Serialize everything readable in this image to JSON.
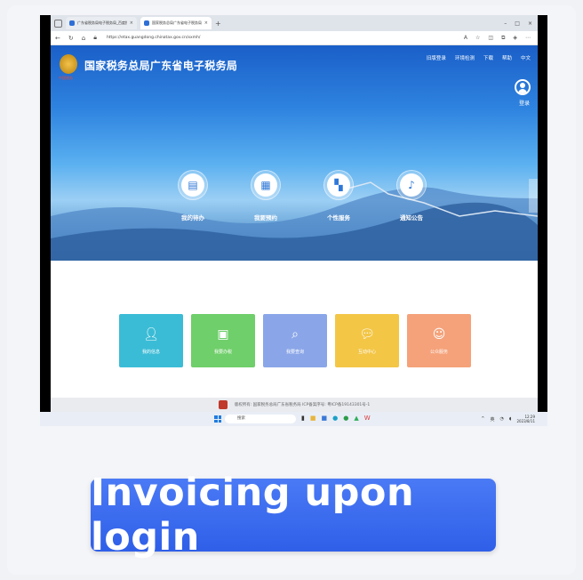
{
  "browser": {
    "tabs": [
      {
        "title": "广东省税务局电子税务局_百度搜",
        "active": false
      },
      {
        "title": "国家税务总局广东省电子税务局",
        "active": true
      }
    ],
    "new_tab": "+",
    "window_controls": [
      "–",
      "□",
      "×"
    ],
    "url": "https://etax.guangdong.chinatax.gov.cn/xxmh/"
  },
  "site": {
    "emblem_caption": "中国税务",
    "title": "国家税务总局广东省电子税务局",
    "top_links": [
      "旧版登录",
      "环境检测",
      "下载",
      "帮助",
      "中文"
    ],
    "login_label": "登录",
    "hero_items": [
      {
        "label": "我的待办",
        "icon": "document-icon"
      },
      {
        "label": "我要预约",
        "icon": "calendar-icon"
      },
      {
        "label": "个性服务",
        "icon": "grid-icon"
      },
      {
        "label": "通知公告",
        "icon": "bell-icon"
      }
    ],
    "tiles": [
      {
        "label": "我的信息",
        "color": "#3bbcd6",
        "icon": "person-icon"
      },
      {
        "label": "我要办税",
        "color": "#6fcf6a",
        "icon": "monitor-icon"
      },
      {
        "label": "我要查询",
        "color": "#8aa6e8",
        "icon": "search-doc-icon"
      },
      {
        "label": "互动中心",
        "color": "#f3c646",
        "icon": "chat-icon"
      },
      {
        "label": "公众服务",
        "color": "#f5a27a",
        "icon": "service-icon"
      }
    ],
    "footer": "版权所有: 国家税务总局广东省税务局    ICP备案序号: 粤ICP备19143301号-1"
  },
  "taskbar": {
    "search_placeholder": "搜索",
    "tray_lang": "英",
    "clock_time": "12:29",
    "clock_date": "2023/8/11"
  },
  "caption": "Invoicing upon login",
  "colors": {
    "caption_bg": "#3566ee",
    "hero_top": "#1a5fc8"
  }
}
